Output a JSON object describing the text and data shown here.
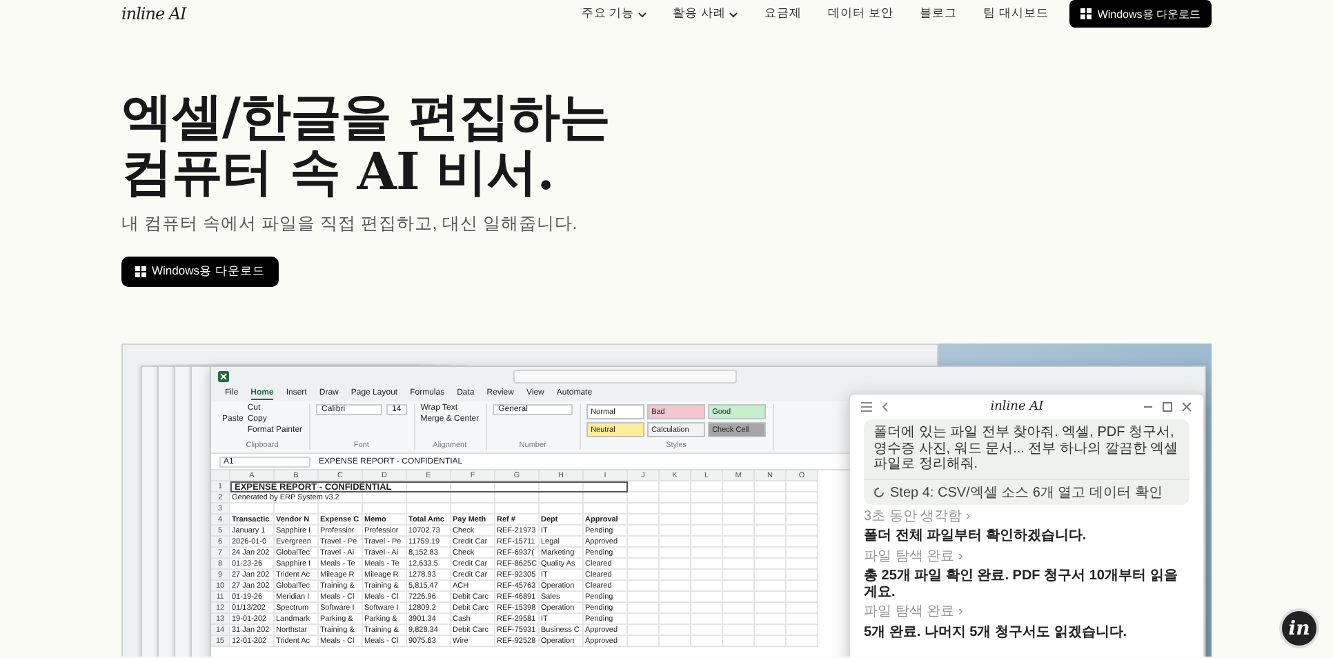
{
  "nav": {
    "logo": "inline AI",
    "items": [
      {
        "label": "주요 기능",
        "dropdown": true
      },
      {
        "label": "활용 사례",
        "dropdown": true
      },
      {
        "label": "요금제",
        "dropdown": false
      },
      {
        "label": "데이터 보안",
        "dropdown": false
      },
      {
        "label": "블로그",
        "dropdown": false
      },
      {
        "label": "팀 대시보드",
        "dropdown": false
      }
    ],
    "cta": "Windows용 다운로드"
  },
  "hero": {
    "title_lines": [
      "엑셀/한글을 편집하는",
      "컴퓨터 속 AI 비서."
    ],
    "subtitle": "내 컴퓨터 속에서 파일을 직접 편집하고, 대신 일해줍니다.",
    "button": "Windows용 다운로드"
  },
  "demo": {
    "excel": {
      "tabs": [
        {
          "label": "File",
          "selected": false
        },
        {
          "label": "Home",
          "selected": true
        },
        {
          "label": "Insert",
          "selected": false
        },
        {
          "label": "Draw",
          "selected": false
        },
        {
          "label": "Page Layout",
          "selected": false
        },
        {
          "label": "Formulas",
          "selected": false
        },
        {
          "label": "Data",
          "selected": false
        },
        {
          "label": "Review",
          "selected": false
        },
        {
          "label": "View",
          "selected": false
        },
        {
          "label": "Automate",
          "selected": false
        }
      ],
      "clipboard": [
        "Paste",
        "Cut",
        "Copy",
        "Format Painter"
      ],
      "font": "Calibri",
      "font_size": "14",
      "alignment": [
        "Wrap Text",
        "Merge & Center"
      ],
      "number_format": "General",
      "styles": [
        {
          "label": "Normal",
          "color": "#ffffff"
        },
        {
          "label": "Bad",
          "color": "#f4c7ce"
        },
        {
          "label": "Good",
          "color": "#c6efce"
        },
        {
          "label": "Neutral",
          "color": "#ffeb9c"
        },
        {
          "label": "Calculation",
          "color": "#f2f2f2"
        },
        {
          "label": "Check Cell",
          "color": "#a5a5a5"
        }
      ],
      "groups": [
        "Clipboard",
        "Font",
        "Alignment",
        "Number",
        "Styles"
      ],
      "name_box": "A1",
      "formula": "EXPENSE REPORT - CONFIDENTIAL",
      "columns": [
        "A",
        "B",
        "C",
        "D",
        "E",
        "F",
        "G",
        "H",
        "I",
        "J",
        "K",
        "L",
        "M",
        "N",
        "O"
      ],
      "rows": [
        {
          "number": "1",
          "kind": "title",
          "cells": [
            "EXPENSE REPORT - CONFIDENTIAL"
          ]
        },
        {
          "number": "2",
          "kind": "plain",
          "cells": [
            "Generated by ERP System v3.2"
          ]
        },
        {
          "number": "3",
          "kind": "plain",
          "cells": []
        },
        {
          "number": "4",
          "kind": "header",
          "cells": [
            "Transactic",
            "Vendor N",
            "Expense C",
            "Memo",
            "Total Amc",
            "Pay Meth",
            "Ref #",
            "Dept",
            "Approval"
          ]
        },
        {
          "number": "5",
          "kind": "data",
          "cells": [
            "January 1",
            "Sapphire I",
            "Professior",
            "Professior",
            "10702.73",
            "Check",
            "REF-21973",
            "IT",
            "Pending"
          ]
        },
        {
          "number": "6",
          "kind": "data",
          "cells": [
            "2026-01-0",
            "Evergreen",
            "Travel - Pe",
            "Travel - Pe",
            "11759.19",
            "Credit Car",
            "REF-15711",
            "Legal",
            "Approved"
          ]
        },
        {
          "number": "7",
          "kind": "data",
          "cells": [
            "24 Jan 202",
            "GlobalTec",
            "Travel - Ai",
            "Travel - Ai",
            "8,152.83",
            "Check",
            "REF-6937(",
            "Marketing",
            "Pending"
          ]
        },
        {
          "number": "8",
          "kind": "data",
          "cells": [
            "01-23-26",
            "Sapphire I",
            "Meals - Te",
            "Meals - Te",
            "12,633.5",
            "Credit Car",
            "REF-8625C",
            "Quality As",
            "Cleared"
          ]
        },
        {
          "number": "9",
          "kind": "data",
          "cells": [
            "27 Jan 202",
            "Trident Ac",
            "Mileage R",
            "Mileage R",
            "1278.93",
            "Credit Car",
            "REF-92305",
            "IT",
            "Cleared"
          ]
        },
        {
          "number": "10",
          "kind": "data",
          "cells": [
            "27 Jan 202",
            "GlobalTec",
            "Training &",
            "Training &",
            "5,815.47",
            "ACH",
            "REF-45763",
            "Operation",
            "Cleared"
          ]
        },
        {
          "number": "11",
          "kind": "data",
          "cells": [
            "01-19-26",
            "Meridian I",
            "Meals - Cl",
            "Meals - Cl",
            "7226.96",
            "Debit Carc",
            "REF-46891",
            "Sales",
            "Pending"
          ]
        },
        {
          "number": "12",
          "kind": "data",
          "cells": [
            "01/13/202",
            "Spectrum",
            "Software I",
            "Software I",
            "12809.2",
            "Debit Carc",
            "REF-15398",
            "Operation",
            "Pending"
          ]
        },
        {
          "number": "13",
          "kind": "data",
          "cells": [
            "19-01-202",
            "Landmark",
            "Parking &",
            "Parking &",
            "3901.34",
            "Cash",
            "REF-29581",
            "IT",
            "Pending"
          ]
        },
        {
          "number": "14",
          "kind": "data",
          "cells": [
            "31 Jan 202",
            "Northstar",
            "Training &",
            "Training &",
            "9,828.34",
            "Debit Carc",
            "REF-75931",
            "Business C",
            "Approved"
          ]
        },
        {
          "number": "15",
          "kind": "data",
          "cells": [
            "12-01-202",
            "Trident Ac",
            "Meals - Cl",
            "Meals - Cl",
            "9075.63",
            "Wire",
            "REF-92528",
            "Operation",
            "Approved"
          ]
        }
      ]
    },
    "assistant": {
      "logo": "inline AI",
      "prompt": "폴더에 있는 파일 전부 찾아줘. 엑셀, PDF 청구서, 영수증 사진, 워드 문서... 전부 하나의 깔끔한 엑셀 파일로 정리해줘.",
      "step": "Step 4: CSV/엑셀 소스 6개 열고 데이터 확인",
      "messages": [
        {
          "kind": "muted",
          "text": "3초 동안 생각함 ›"
        },
        {
          "kind": "bold",
          "text": "폴더 전체 파일부터 확인하겠습니다."
        },
        {
          "kind": "muted",
          "text": "파일 탐색 완료 ›"
        },
        {
          "kind": "bold",
          "text": "총 25개 파일 확인 완료. PDF 청구서 10개부터 읽을게요."
        },
        {
          "kind": "muted",
          "text": "파일 탐색 완료 ›"
        },
        {
          "kind": "bold",
          "text": "5개 완료. 나머지 5개 청구서도 읽겠습니다."
        }
      ]
    }
  },
  "fab": {
    "label": "in"
  }
}
